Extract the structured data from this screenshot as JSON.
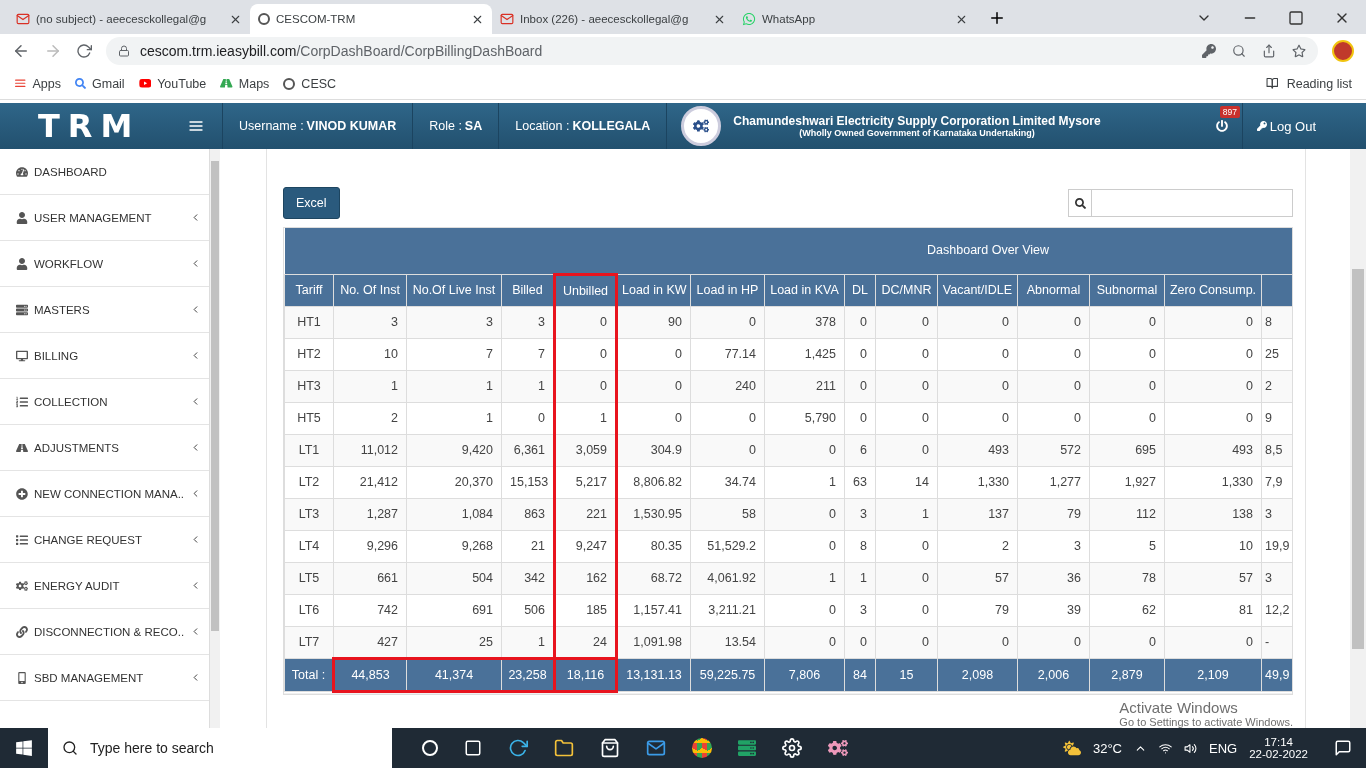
{
  "browser": {
    "tabs": [
      {
        "title": "(no subject) - aeecesckollegal@g",
        "selected": false,
        "kind": "mail"
      },
      {
        "title": "CESCOM-TRM",
        "selected": true,
        "kind": "site"
      },
      {
        "title": "Inbox (226) - aeecesckollegal@g",
        "selected": false,
        "kind": "mail"
      },
      {
        "title": "WhatsApp",
        "selected": false,
        "kind": "chat"
      }
    ],
    "url": {
      "host": "cescom.trm.ieasybill.com",
      "path": "/CorpDashBoard/CorpBillingDashBoard"
    },
    "bookmarks": [
      {
        "label": "Apps",
        "kind": "apps"
      },
      {
        "label": "Gmail",
        "kind": "g"
      },
      {
        "label": "YouTube",
        "kind": "yt"
      },
      {
        "label": "Maps",
        "kind": "maps"
      },
      {
        "label": "CESC",
        "kind": "site"
      }
    ],
    "reading_list": "Reading list"
  },
  "header": {
    "logo": "TRM",
    "fields": [
      {
        "label": "Username :",
        "value": "VINOD KUMAR"
      },
      {
        "label": "Role :",
        "value": "SA"
      },
      {
        "label": "Location :",
        "value": "KOLLEGALA"
      }
    ],
    "org_name": "Chamundeshwari Electricity Supply Corporation Limited Mysore",
    "org_subtitle": "(Wholly Owned Government of Karnataka Undertaking)",
    "badge": "897",
    "logout": "Log Out"
  },
  "sidebar": {
    "items": [
      {
        "label": "DASHBOARD",
        "expandable": false
      },
      {
        "label": "USER MANAGEMENT",
        "expandable": true
      },
      {
        "label": "WORKFLOW",
        "expandable": true
      },
      {
        "label": "MASTERS",
        "expandable": true
      },
      {
        "label": "BILLING",
        "expandable": true
      },
      {
        "label": "COLLECTION",
        "expandable": true
      },
      {
        "label": "ADJUSTMENTS",
        "expandable": true
      },
      {
        "label": "NEW CONNECTION MANA..",
        "expandable": true
      },
      {
        "label": "CHANGE REQUEST",
        "expandable": true
      },
      {
        "label": "ENERGY AUDIT",
        "expandable": true
      },
      {
        "label": "DISCONNECTION & RECO..",
        "expandable": true
      },
      {
        "label": "SBD MANAGEMENT",
        "expandable": true
      }
    ]
  },
  "toolbar": {
    "excel": "Excel"
  },
  "table": {
    "title": "Dashboard Over View",
    "columns": [
      {
        "label": "Tariff"
      },
      {
        "label": "No. Of Inst",
        "total_boxed": true
      },
      {
        "label": "No.Of Live Inst",
        "total_boxed": true
      },
      {
        "label": "Billed",
        "total_boxed": true
      },
      {
        "label": "Unbilled",
        "column_boxed": true
      },
      {
        "label": "Load in KW"
      },
      {
        "label": "Load in HP"
      },
      {
        "label": "Load in KVA"
      },
      {
        "label": "DL"
      },
      {
        "label": "DC/MNR"
      },
      {
        "label": "Vacant/IDLE"
      },
      {
        "label": "Abnormal"
      },
      {
        "label": "Subnormal"
      },
      {
        "label": "Zero Consump."
      },
      {
        "clipped": true
      }
    ],
    "rows": [
      [
        "HT1",
        "3",
        "3",
        "3",
        "0",
        "90",
        "0",
        "378",
        "0",
        "0",
        "0",
        "0",
        "0",
        "0",
        "8"
      ],
      [
        "HT2",
        "10",
        "7",
        "7",
        "0",
        "0",
        "77.14",
        "1,425",
        "0",
        "0",
        "0",
        "0",
        "0",
        "0",
        "25"
      ],
      [
        "HT3",
        "1",
        "1",
        "1",
        "0",
        "0",
        "240",
        "211",
        "0",
        "0",
        "0",
        "0",
        "0",
        "0",
        "2"
      ],
      [
        "HT5",
        "2",
        "1",
        "0",
        "1",
        "0",
        "0",
        "5,790",
        "0",
        "0",
        "0",
        "0",
        "0",
        "0",
        "9"
      ],
      [
        "LT1",
        "11,012",
        "9,420",
        "6,361",
        "3,059",
        "304.9",
        "0",
        "0",
        "6",
        "0",
        "493",
        "572",
        "695",
        "493",
        "8,5"
      ],
      [
        "LT2",
        "21,412",
        "20,370",
        "15,153",
        "5,217",
        "8,806.82",
        "34.74",
        "1",
        "63",
        "14",
        "1,330",
        "1,277",
        "1,927",
        "1,330",
        "7,9"
      ],
      [
        "LT3",
        "1,287",
        "1,084",
        "863",
        "221",
        "1,530.95",
        "58",
        "0",
        "3",
        "1",
        "137",
        "79",
        "112",
        "138",
        "3"
      ],
      [
        "LT4",
        "9,296",
        "9,268",
        "21",
        "9,247",
        "80.35",
        "51,529.2",
        "0",
        "8",
        "0",
        "2",
        "3",
        "5",
        "10",
        "19,9"
      ],
      [
        "LT5",
        "661",
        "504",
        "342",
        "162",
        "68.72",
        "4,061.92",
        "1",
        "1",
        "0",
        "57",
        "36",
        "78",
        "57",
        "3"
      ],
      [
        "LT6",
        "742",
        "691",
        "506",
        "185",
        "1,157.41",
        "3,211.21",
        "0",
        "3",
        "0",
        "79",
        "39",
        "62",
        "81",
        "12,2"
      ],
      [
        "LT7",
        "427",
        "25",
        "1",
        "24",
        "1,091.98",
        "13.54",
        "0",
        "0",
        "0",
        "0",
        "0",
        "0",
        "0",
        "-"
      ]
    ],
    "total": {
      "label": "Total :",
      "values": [
        "44,853",
        "41,374",
        "23,258",
        "18,116",
        "13,131.13",
        "59,225.75",
        "7,806",
        "84",
        "15",
        "2,098",
        "2,006",
        "2,879",
        "2,109",
        "49,9"
      ]
    }
  },
  "activation": {
    "title": "Activate Windows",
    "hint": "Go to Settings to activate Windows."
  },
  "taskbar": {
    "search": "Type here to search",
    "temperature": "32°C",
    "language": "ENG",
    "time": "17:14",
    "date": "22-02-2022"
  }
}
